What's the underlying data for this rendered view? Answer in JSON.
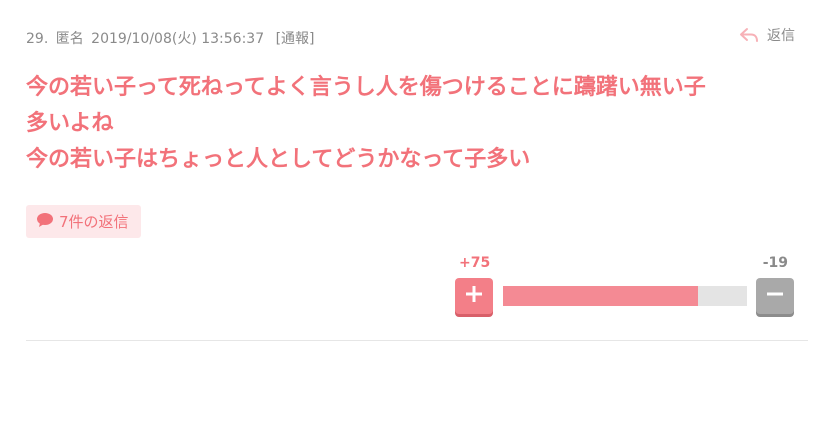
{
  "comment": {
    "number": "29.",
    "author": "匿名",
    "datetime": "2019/10/08(火) 13:56:37",
    "report_label": "[通報]",
    "reply_label": "返信",
    "body_lines": [
      "今の若い子って死ねってよく言うし人を傷つけることに躊躇い無い子",
      "多いよね",
      "今の若い子はちょっと人としてどうかなって子多い"
    ],
    "replies_label": "7件の返信"
  },
  "votes": {
    "plus_count": "+75",
    "minus_count": "-19",
    "plus_ratio": 0.798
  },
  "colors": {
    "accent": "#f2727a",
    "meta_text": "#8a8a8a",
    "bar_fill": "#f48a94",
    "bar_track": "#e4e4e4",
    "minus_button": "#a9a9a9"
  }
}
